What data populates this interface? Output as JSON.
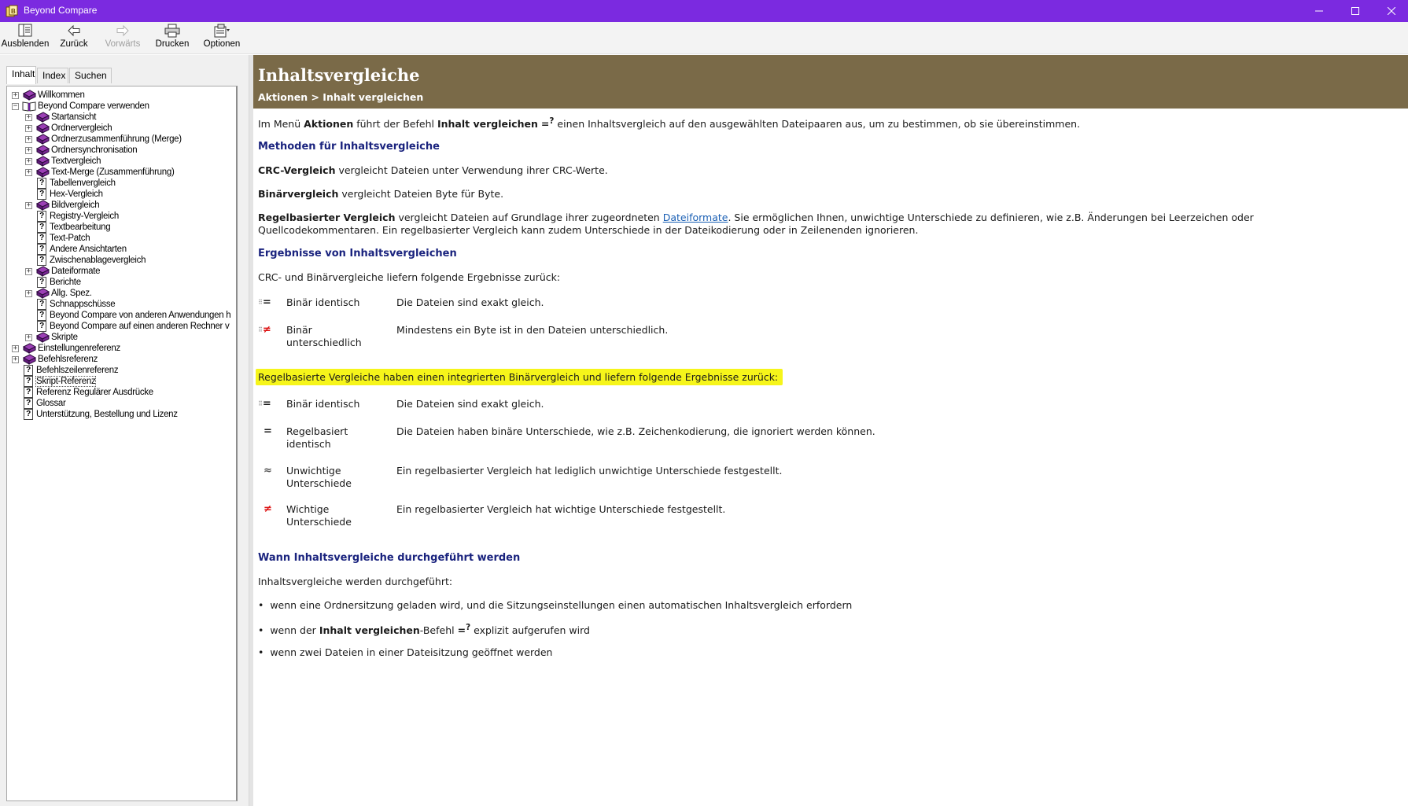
{
  "window": {
    "title": "Beyond Compare"
  },
  "toolbar": {
    "hide": "Ausblenden",
    "back": "Zurück",
    "forward": "Vorwärts",
    "print": "Drucken",
    "options": "Optionen"
  },
  "tabs": {
    "contents": "Inhalt",
    "index": "Index",
    "search": "Suchen"
  },
  "tree": [
    "Willkommen",
    "Beyond Compare verwenden",
    "Startansicht",
    "Ordnervergleich",
    "Ordnerzusammenführung (Merge)",
    "Ordnersynchronisation",
    "Textvergleich",
    "Text-Merge (Zusammenführung)",
    "Tabellenvergleich",
    "Hex-Vergleich",
    "Bildvergleich",
    "Registry-Vergleich",
    "Textbearbeitung",
    "Text-Patch",
    "Andere Ansichtarten",
    "Zwischenablagevergleich",
    "Dateiformate",
    "Berichte",
    "Allg. Spez.",
    "Schnappschüsse",
    "Beyond Compare von anderen Anwendungen h",
    "Beyond Compare auf einen anderen Rechner v",
    "Skripte",
    "Einstellungenreferenz",
    "Befehlsreferenz",
    "Befehlszeilenreferenz",
    "Skript-Referenz",
    "Referenz Regulärer Ausdrücke",
    "Glossar",
    "Unterstützung, Bestellung und Lizenz"
  ],
  "content": {
    "title": "Inhaltsvergleiche",
    "crumb": "Aktionen > Inhalt vergleichen",
    "intro": {
      "a": "Im Menü ",
      "b": "Aktionen",
      "c": " führt der Befehl ",
      "d": "Inhalt vergleichen",
      "e": " einen Inhaltsvergleich auf den ausgewählten Dateipaaren aus, um zu bestimmen, ob sie übereinstimmen."
    },
    "h_methods": "Methoden für Inhaltsvergleiche",
    "crc": {
      "b": "CRC-Vergleich",
      "t": " vergleicht Dateien unter Verwendung ihrer CRC-Werte."
    },
    "bin": {
      "b": "Binärvergleich",
      "t": " vergleicht Dateien Byte für Byte."
    },
    "rule": {
      "b": "Regelbasierter Vergleich",
      "t1": " vergleicht Dateien auf Grundlage ihrer zugeordneten ",
      "link": "Dateiformate",
      "t2": ".  Sie ermöglichen Ihnen, unwichtige Unterschiede zu definieren, wie z.B. Änderungen bei Leerzeichen oder",
      "t3": "Quellcodekommentaren.  Ein regelbasierter Vergleich kann zudem Unterschiede in der Dateikodierung oder in Zeilenenden ignorieren."
    },
    "h_results": "Ergebnisse von Inhaltsvergleichen",
    "results_intro": "CRC- und Binärvergleiche liefern folgende Ergebnisse zurück:",
    "results1": [
      {
        "l1": "Binär identisch",
        "l2": "",
        "desc": "Die Dateien sind exakt gleich."
      },
      {
        "l1": "Binär",
        "l2": "unterschiedlich",
        "desc": "Mindestens ein Byte ist in den Dateien unterschiedlich."
      }
    ],
    "highlight": "Regelbasierte Vergleiche haben einen integrierten Binärvergleich und liefern folgende Ergebnisse zurück:",
    "results2": [
      {
        "l1": "Binär identisch",
        "l2": "",
        "desc": "Die Dateien sind exakt gleich."
      },
      {
        "l1": "Regelbasiert",
        "l2": "identisch",
        "desc": "Die Dateien haben binäre Unterschiede, wie z.B. Zeichenkodierung, die ignoriert werden können."
      },
      {
        "l1": "Unwichtige",
        "l2": "Unterschiede",
        "desc": "Ein regelbasierter Vergleich hat lediglich unwichtige Unterschiede festgestellt."
      },
      {
        "l1": "Wichtige",
        "l2": "Unterschiede",
        "desc": "Ein regelbasierter Vergleich hat wichtige Unterschiede festgestellt."
      }
    ],
    "h_when": "Wann Inhaltsvergleiche durchgeführt werden",
    "when_intro": "Inhaltsvergleiche werden durchgeführt:",
    "bullets": {
      "b1": "wenn eine Ordnersitzung geladen wird, und die Sitzungseinstellungen einen automatischen Inhaltsvergleich erfordern",
      "b2a": "wenn der ",
      "b2b": "Inhalt vergleichen",
      "b2c": "-Befehl",
      "b2d": " explizit aufgerufen wird",
      "b3": "wenn zwei Dateien in einer Dateisitzung geöffnet werden"
    }
  }
}
